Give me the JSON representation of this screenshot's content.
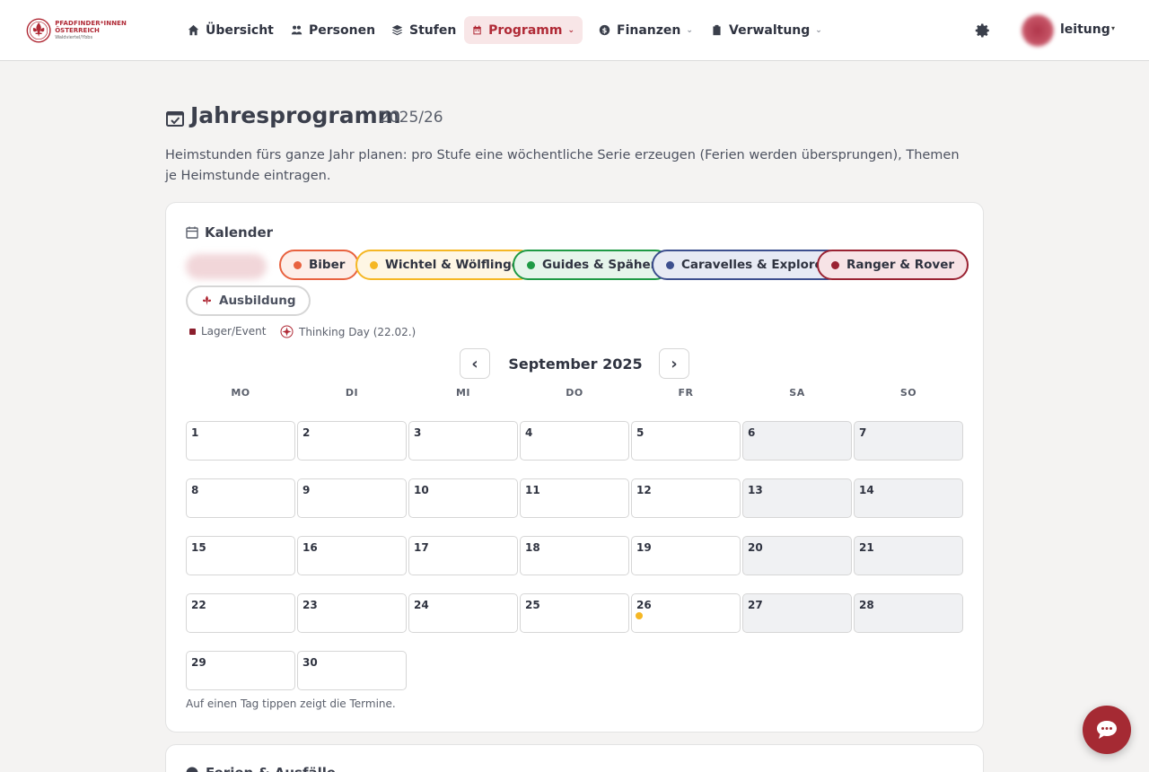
{
  "brand": {
    "line1": "PFADFINDER*INNEN",
    "line2": "ÖSTERREICH",
    "line3": "Waldviertel/Ybbs"
  },
  "nav": [
    {
      "label": "Übersicht",
      "icon": "home-icon"
    },
    {
      "label": "Personen",
      "icon": "people-icon"
    },
    {
      "label": "Stufen",
      "icon": "layers-icon"
    },
    {
      "label": "Programm",
      "icon": "calendar-icon",
      "active": true,
      "dropdown": true
    },
    {
      "label": "Finanzen",
      "icon": "coin-icon",
      "dropdown": true
    },
    {
      "label": "Verwaltung",
      "icon": "clipboard-icon",
      "dropdown": true
    }
  ],
  "user": {
    "name": "leitung",
    "caret": "▾"
  },
  "page": {
    "title": "Jahresprogramm",
    "year": "2025/26",
    "description": "Heimstunden fürs ganze Jahr planen: pro Stufe eine wöchentliche Serie erzeugen (Ferien werden übersprungen), Themen je Heimstunde eintragen."
  },
  "calendar": {
    "title": "Kalender",
    "filters": [
      {
        "label": "Biber",
        "color": "#e8623f",
        "bg": "#fdeee8"
      },
      {
        "label": "Wichtel & Wölflinge",
        "color": "#f5b724",
        "bg": "#fef6e4"
      },
      {
        "label": "Guides & Späher",
        "color": "#1f9a45",
        "bg": "#e6f5eb"
      },
      {
        "label": "Caravelles & Explorer",
        "color": "#3d4f8e",
        "bg": "#e7eaf4"
      },
      {
        "label": "Ranger & Rover",
        "color": "#9a2232",
        "bg": "#f7e3e6"
      },
      {
        "label": "Ausbildung",
        "color": "#b02a36",
        "bg": "#ffffff"
      }
    ],
    "legend": {
      "event": "Lager/Event",
      "thinking_day": "Thinking Day (22.02.)"
    },
    "prev": "‹",
    "next": "›",
    "month_label": "September 2025",
    "weekdays": [
      "MO",
      "DI",
      "MI",
      "DO",
      "FR",
      "SA",
      "SO"
    ],
    "first_weekday_index": 0,
    "days_in_month": 30,
    "events": [
      {
        "day": 26,
        "color": "#f5b724"
      }
    ],
    "hint": "Auf einen Tag tippen zeigt die Termine."
  },
  "next_card": {
    "title": "Ferien & Ausfälle"
  }
}
